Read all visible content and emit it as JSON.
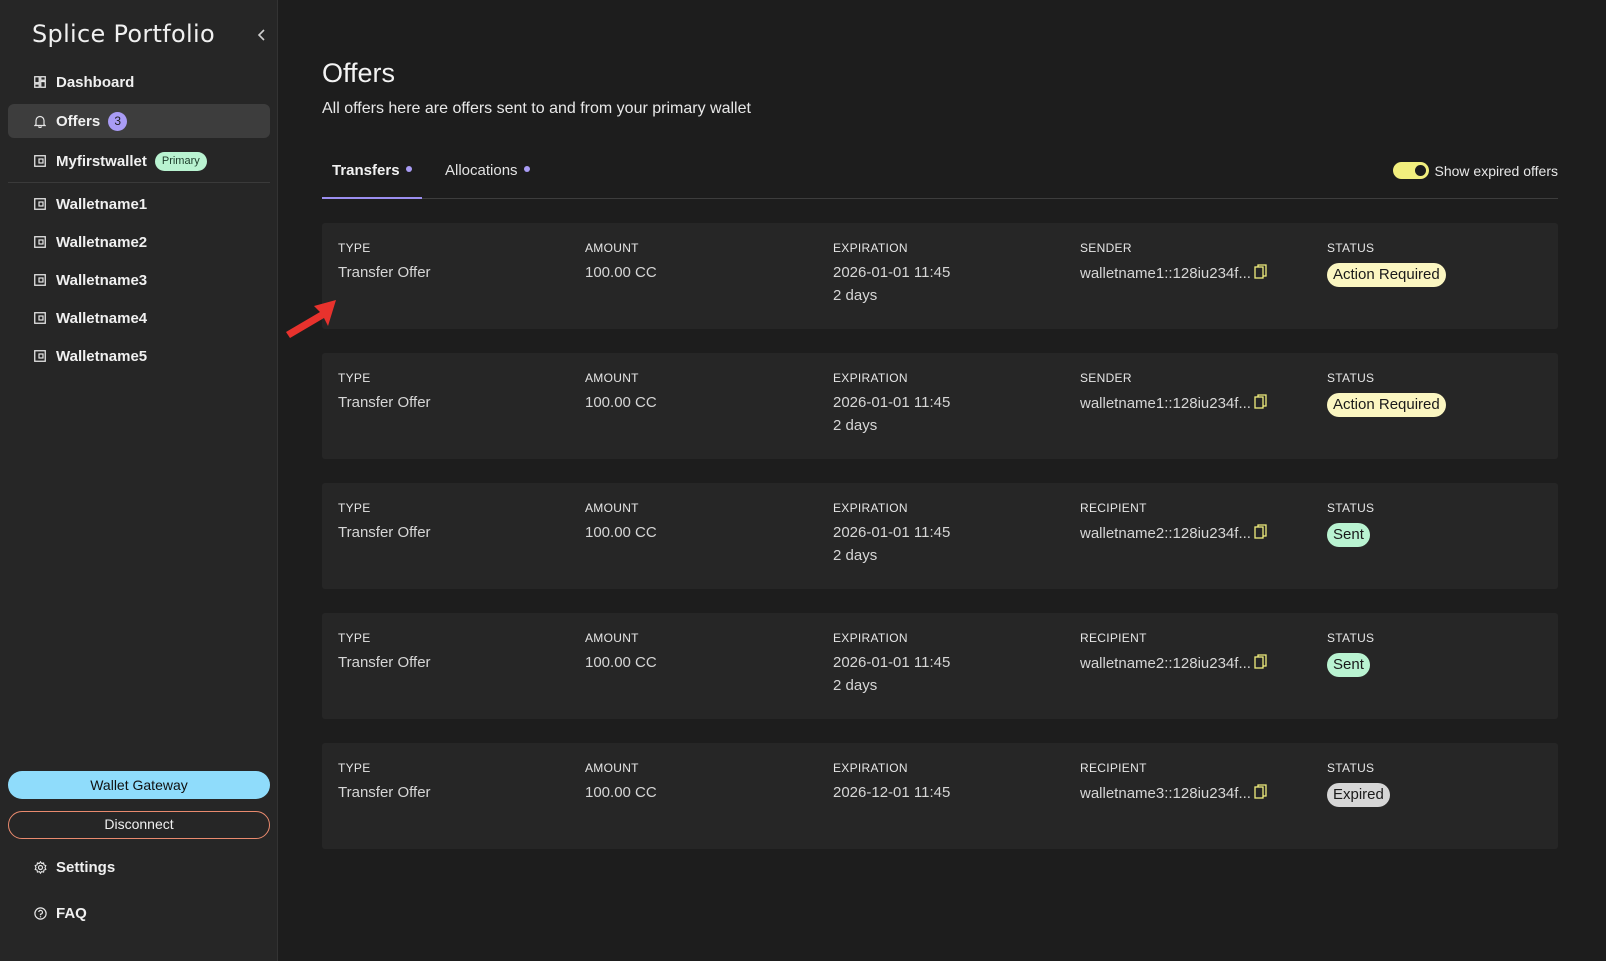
{
  "sidebar": {
    "brand": "Splice Portfolio",
    "collapse_icon": "chevron-left-icon",
    "items": [
      {
        "label": "Dashboard",
        "icon": "grid-icon"
      },
      {
        "label": "Offers",
        "icon": "bell-icon",
        "count": "3",
        "active": true
      },
      {
        "label": "Myfirstwallet",
        "icon": "wallet-icon",
        "badge": "Primary"
      },
      {
        "label": "Walletname1",
        "icon": "wallet-icon"
      },
      {
        "label": "Walletname2",
        "icon": "wallet-icon"
      },
      {
        "label": "Walletname3",
        "icon": "wallet-icon"
      },
      {
        "label": "Walletname4",
        "icon": "wallet-icon"
      },
      {
        "label": "Walletname5",
        "icon": "wallet-icon"
      }
    ],
    "gateway_label": "Wallet Gateway",
    "disconnect_label": "Disconnect",
    "settings_label": "Settings",
    "faq_label": "FAQ"
  },
  "main": {
    "title": "Offers",
    "subtitle": "All offers here are offers sent to and from your primary wallet",
    "tabs": [
      {
        "label": "Transfers",
        "active": true
      },
      {
        "label": "Allocations",
        "active": false
      }
    ],
    "toggle_label": "Show expired offers",
    "toggle_on": true,
    "labels": {
      "type": "TYPE",
      "amount": "AMOUNT",
      "expiration": "EXPIRATION",
      "status": "STATUS"
    },
    "offers": [
      {
        "type": "Transfer Offer",
        "amount": "100.00 CC",
        "expiration": "2026-01-01 11:45",
        "remaining": "2 days",
        "party_label": "SENDER",
        "party": "walletname1::128iu234f...",
        "status": "Action Required"
      },
      {
        "type": "Transfer Offer",
        "amount": "100.00 CC",
        "expiration": "2026-01-01 11:45",
        "remaining": "2 days",
        "party_label": "SENDER",
        "party": "walletname1::128iu234f...",
        "status": "Action Required"
      },
      {
        "type": "Transfer Offer",
        "amount": "100.00 CC",
        "expiration": "2026-01-01 11:45",
        "remaining": "2 days",
        "party_label": "RECIPIENT",
        "party": "walletname2::128iu234f...",
        "status": "Sent"
      },
      {
        "type": "Transfer Offer",
        "amount": "100.00 CC",
        "expiration": "2026-01-01 11:45",
        "remaining": "2 days",
        "party_label": "RECIPIENT",
        "party": "walletname2::128iu234f...",
        "status": "Sent"
      },
      {
        "type": "Transfer Offer",
        "amount": "100.00 CC",
        "expiration": "2026-12-01 11:45",
        "remaining": "",
        "party_label": "RECIPIENT",
        "party": "walletname3::128iu234f...",
        "status": "Expired"
      }
    ]
  },
  "colors": {
    "accent": "#a99cf5",
    "action_required": "#fbf6c1",
    "sent": "#b9f3d1",
    "expired": "#d6d6d6",
    "gateway": "#8fdcfb",
    "disconnect_border": "#e98a6e",
    "toggle": "#f2ef7e",
    "annotation_arrow": "#e8322d"
  }
}
